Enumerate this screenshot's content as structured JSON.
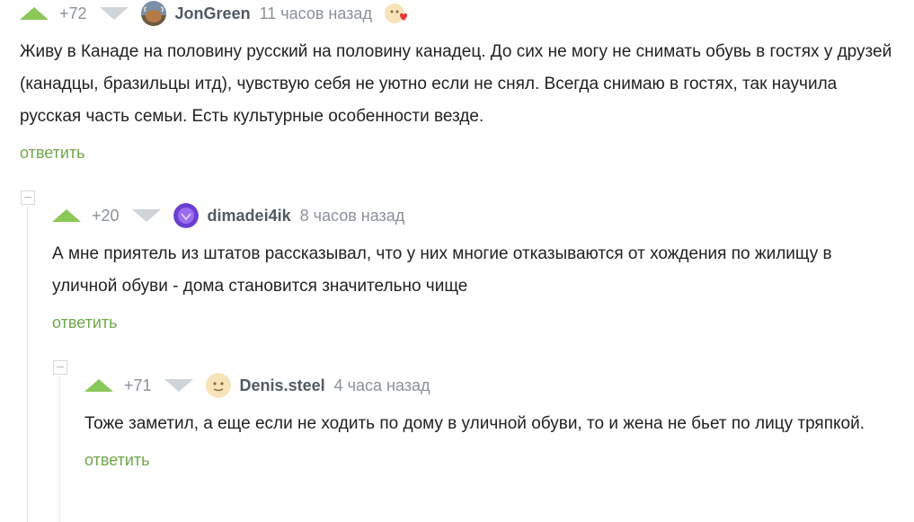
{
  "comments": [
    {
      "rating": "+72",
      "author": "JonGreen",
      "time": "11 часов назад",
      "text": "Живу в Канаде на половину русский на половину канадец. До сих не могу не снимать обувь в гостях у друзей (канадцы, бразильцы итд), чувствую себя не уютно если не снял. Всегда снимаю в гостях, так научила русская часть семьи. Есть культурные особенности везде.",
      "reply_label": "ответить",
      "avatar_icon": "user-avatar-highland-cow",
      "badge_icon": "heart-badge-icon"
    },
    {
      "rating": "+20",
      "author": "dimadei4ik",
      "time": "8 часов назад",
      "text": "А мне приятель из штатов рассказывал, что у них многие отказываются от хождения по жилищу в уличной обуви - дома становится значительно чище",
      "reply_label": "ответить",
      "avatar_icon": "user-avatar-purple"
    },
    {
      "rating": "+71",
      "author": "Denis.steel",
      "time": "4 часа назад",
      "text": "Тоже заметил, а еще если не ходить по дому в уличной обуви, то и жена не бьет по лицу тряпкой.",
      "reply_label": "ответить",
      "avatar_icon": "user-avatar-default-yellow"
    }
  ],
  "colors": {
    "upvote": "#8ac858",
    "downvote": "#cfd4d8",
    "reply_link": "#6fa84a",
    "meta_text": "#8a9198"
  }
}
